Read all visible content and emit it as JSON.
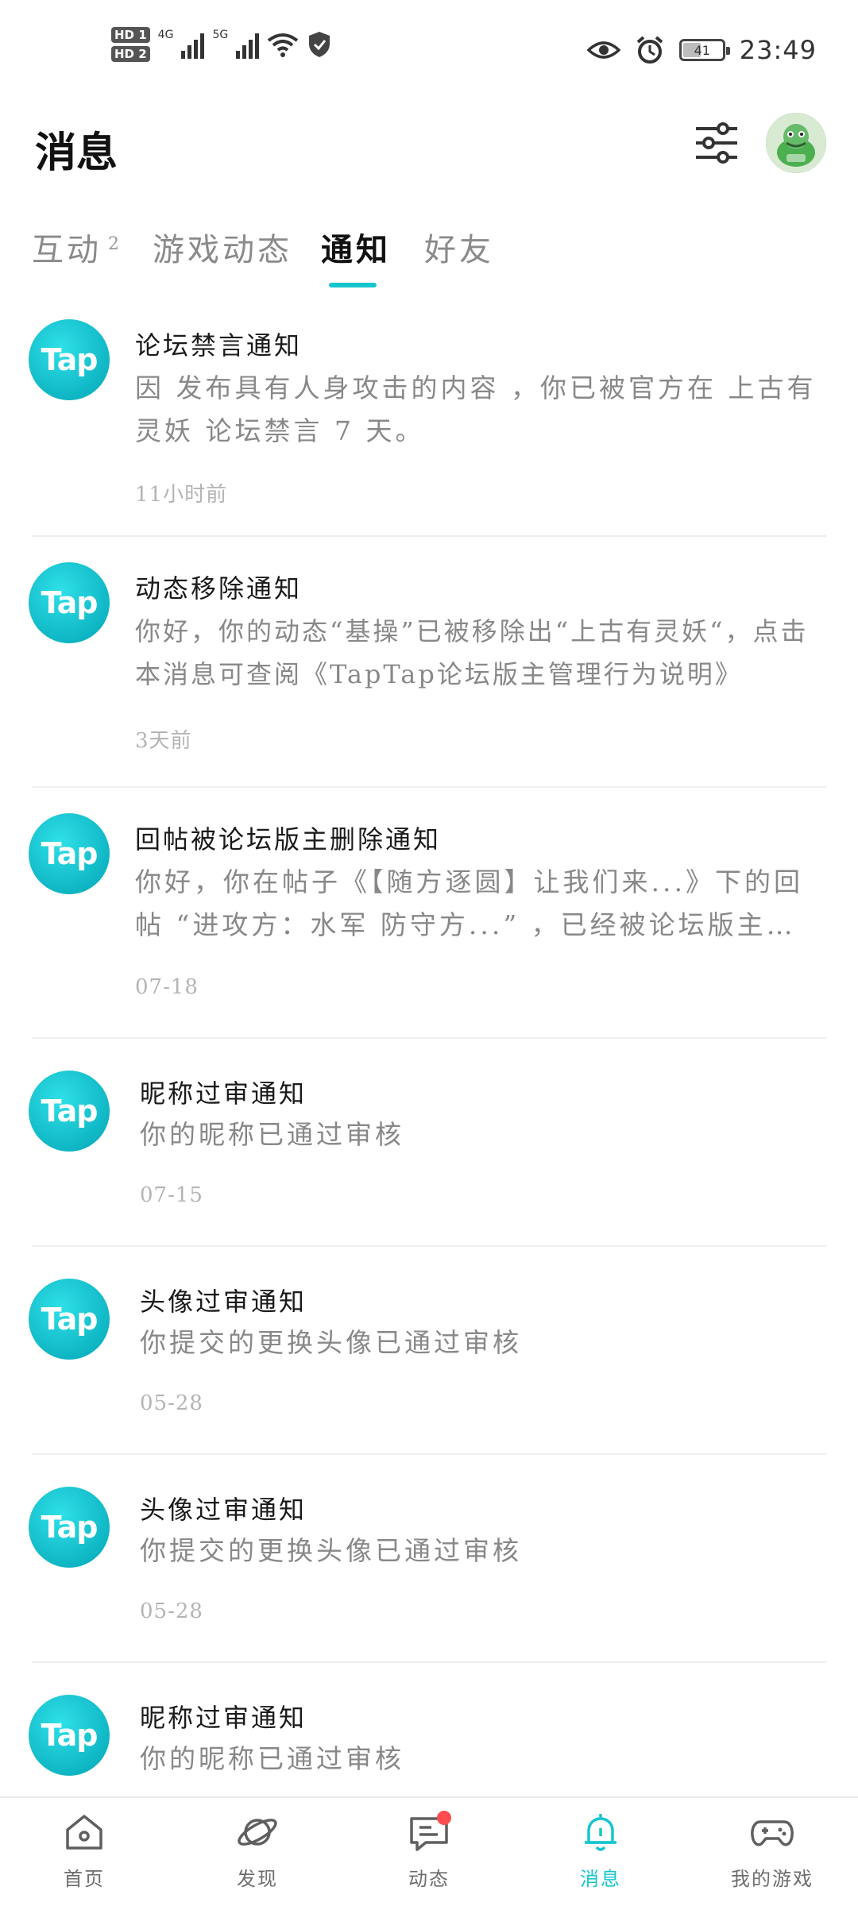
{
  "status_bar": {
    "hd_badges": [
      "HD 1",
      "HD 2"
    ],
    "network_1": "4G",
    "network_2": "5G",
    "battery": "41",
    "time": "23:49"
  },
  "header": {
    "title": "消息"
  },
  "tabs": [
    {
      "label": "互动",
      "badge": "2",
      "active": false
    },
    {
      "label": "游戏动态",
      "active": false
    },
    {
      "label": "通知",
      "active": true
    },
    {
      "label": "好友",
      "active": false
    }
  ],
  "notifications": [
    {
      "icon_text": "Tap",
      "title": "论坛禁言通知",
      "body": "因 发布具有人身攻击的内容 ，你已被官方在 上古有灵妖 论坛禁言 7 天。",
      "time": "11小时前"
    },
    {
      "icon_text": "Tap",
      "title": "动态移除通知",
      "body": "你好，你的动态“基操”已被移除出“上古有灵妖“，点击本消息可查阅《TapTap论坛版主管理行为说明》",
      "time": "3天前"
    },
    {
      "icon_text": "Tap",
      "title": "回帖被论坛版主删除通知",
      "body_line1": "你好，你在帖子《【随方逐圆】让我们来...》下的回",
      "body_line2": "帖 “进攻方：水军 防守方...” ，已经被论坛版主…",
      "time": "07-18"
    },
    {
      "icon_text": "Tap",
      "title": "昵称过审通知",
      "body": "你的昵称已通过审核",
      "time": "07-15"
    },
    {
      "icon_text": "Tap",
      "title": "头像过审通知",
      "body": "你提交的更换头像已通过审核",
      "time": "05-28"
    },
    {
      "icon_text": "Tap",
      "title": "头像过审通知",
      "body": "你提交的更换头像已通过审核",
      "time": "05-28"
    },
    {
      "icon_text": "Tap",
      "title": "昵称过审通知",
      "body": "你的昵称已通过审核"
    }
  ],
  "bottom_nav": [
    {
      "label": "首页",
      "icon": "home-icon"
    },
    {
      "label": "发现",
      "icon": "planet-icon"
    },
    {
      "label": "动态",
      "icon": "chat-icon",
      "badge_dot": true
    },
    {
      "label": "消息",
      "icon": "bell-icon",
      "active": true
    },
    {
      "label": "我的游戏",
      "icon": "gamepad-icon"
    }
  ],
  "colors": {
    "accent": "#15c5ce",
    "badge": "#ff4d4f",
    "tap_brand": "#14c0cc"
  }
}
